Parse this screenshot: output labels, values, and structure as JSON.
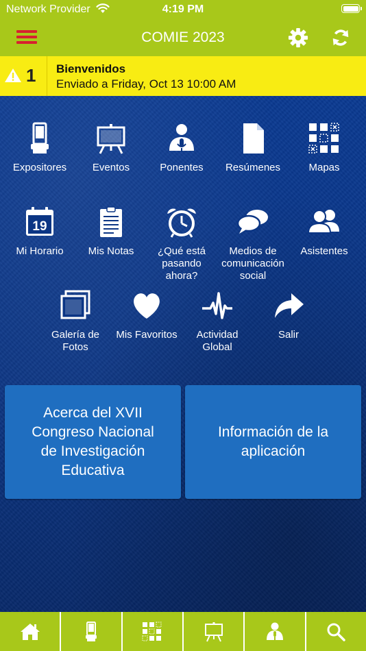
{
  "status_bar": {
    "carrier": "Network Provider",
    "time": "4:19 PM"
  },
  "nav": {
    "title": "COMIE 2023",
    "menu_icon": "hamburger-icon",
    "settings_icon": "gear-icon",
    "refresh_icon": "refresh-icon"
  },
  "notice": {
    "count": "1",
    "title": "Bienvenidos",
    "subtitle": "Enviado a Friday, Oct 13 10:00 AM"
  },
  "tiles": [
    {
      "label": "Expositores",
      "icon": "kiosk-icon"
    },
    {
      "label": "Eventos",
      "icon": "easel-icon"
    },
    {
      "label": "Ponentes",
      "icon": "speaker-icon"
    },
    {
      "label": "Resúmenes",
      "icon": "document-icon"
    },
    {
      "label": "Mapas",
      "icon": "floorplan-icon"
    },
    {
      "label": "Mi Horario",
      "icon": "calendar-icon",
      "day": "19"
    },
    {
      "label": "Mis Notas",
      "icon": "notepad-icon"
    },
    {
      "label": "¿Qué está pasando ahora?",
      "icon": "alarm-clock-icon"
    },
    {
      "label": "Medios de comunicación social",
      "icon": "chat-bubbles-icon"
    },
    {
      "label": "Asistentes",
      "icon": "people-icon"
    },
    {
      "label": "Galería de Fotos",
      "icon": "photos-icon"
    },
    {
      "label": "Mis Favoritos",
      "icon": "heart-icon"
    },
    {
      "label": "Actividad Global",
      "icon": "pulse-icon"
    },
    {
      "label": "Salir",
      "icon": "share-arrow-icon"
    }
  ],
  "buttons": {
    "about": "Acerca del XVII Congreso Nacional de Investigación Educativa",
    "app_info": "Información de la aplicación"
  },
  "tab_bar": [
    {
      "icon": "home-icon"
    },
    {
      "icon": "kiosk-icon"
    },
    {
      "icon": "floorplan-icon"
    },
    {
      "icon": "easel-icon"
    },
    {
      "icon": "speaker-icon"
    },
    {
      "icon": "search-icon"
    }
  ],
  "colors": {
    "header": "#a8c81a",
    "notice": "#f8ec13",
    "button": "#1f6ec0",
    "menu_icon": "#d7212f",
    "background": "#0b3584"
  }
}
